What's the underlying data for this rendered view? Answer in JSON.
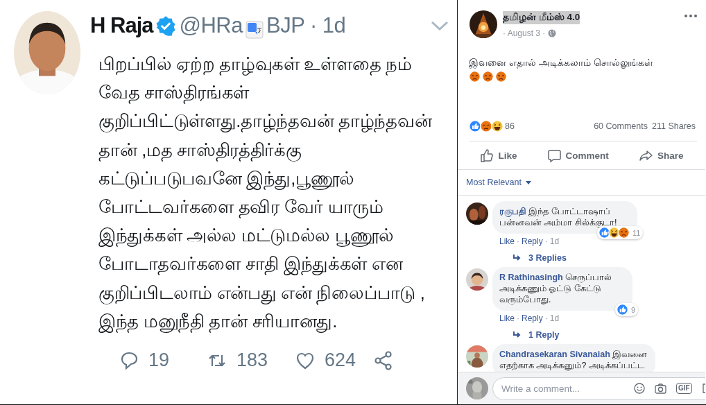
{
  "tweet": {
    "name": "H Raja",
    "verified": true,
    "handle_start": "@HRa",
    "handle_end": "BJP · 1d",
    "text": "பிறப்பில் ஏற்ற தாழ்வுகள் உள்ளதை நம்\nவேத சாஸ்திரங்கள்\nகுறிப்பிட்டுள்ளது.தாழ்ந்தவன் தாழ்ந்தவன்\nதான் ,மத சாஸ்திரத்திர்க்கு\nகட்டுப்படுபவனே இந்து,பூணூல்\nபோட்டவர்களை தவிர வேர் யாரும்\nஇந்துக்கள் அல்ல மட்டுமல்ல பூணூல்\nபோடாதவர்களை சாதி இந்துக்கள் என\nகுறிப்பிடலாம் என்பது என் நிலைப்பாடு ,\nஇந்த மனுநீதி தான் சரியானது.",
    "actions": [
      {
        "kind": "reply",
        "count": "19"
      },
      {
        "kind": "retweet",
        "count": "183"
      },
      {
        "kind": "like",
        "count": "624"
      },
      {
        "kind": "share"
      }
    ]
  },
  "post": {
    "page_name": "தமிழன் மீம்ஸ் 4.0",
    "date": "· August 3 ·",
    "text": "இவனை எதால் அடிக்கலாம் சொல்லுங்கள்",
    "emojis": [
      {
        "kind": "angry"
      },
      {
        "kind": "angry"
      },
      {
        "kind": "angry"
      }
    ],
    "reactions": [
      {
        "kind": "like"
      },
      {
        "kind": "angry"
      },
      {
        "kind": "haha"
      }
    ],
    "reaction_count": "86",
    "comments_count": "60 Comments",
    "shares_count": "211 Shares",
    "actions": [
      {
        "kind": "like",
        "label": "Like"
      },
      {
        "kind": "comment",
        "label": "Comment"
      },
      {
        "kind": "share",
        "label": "Share"
      }
    ],
    "sort": "Most Relevant",
    "comments": [
      {
        "author": "ரகுபதி",
        "text": "இந்த போட்டாஷாப்\nபன்னவன் அம்மா சில்க்குடா!",
        "reactions": [
          {
            "kind": "like"
          },
          {
            "kind": "haha"
          },
          {
            "kind": "angry"
          }
        ],
        "reaction_count": "11",
        "separator": "·",
        "like": "Like",
        "reply": "Reply",
        "time": "1d",
        "replies": "3 Replies"
      },
      {
        "author": "R Rathinasingh",
        "text": "செருப்பால்\nஅடிக்கணும் ஓட்டு கேட்டு\nவரும்போது.",
        "reactions": [
          {
            "kind": "like"
          }
        ],
        "reaction_count": "9",
        "separator": "·",
        "like": "Like",
        "reply": "Reply",
        "time": "1d",
        "replies": "1 Reply"
      },
      {
        "author": "Chandrasekaran Sivanaiah",
        "text": "இவனை\nஎதற்காக அடிக்கனும்? அடிக்கப்பட்ட"
      }
    ],
    "composer": {
      "placeholder": "Write a comment...",
      "gif_label": "GIF"
    }
  }
}
